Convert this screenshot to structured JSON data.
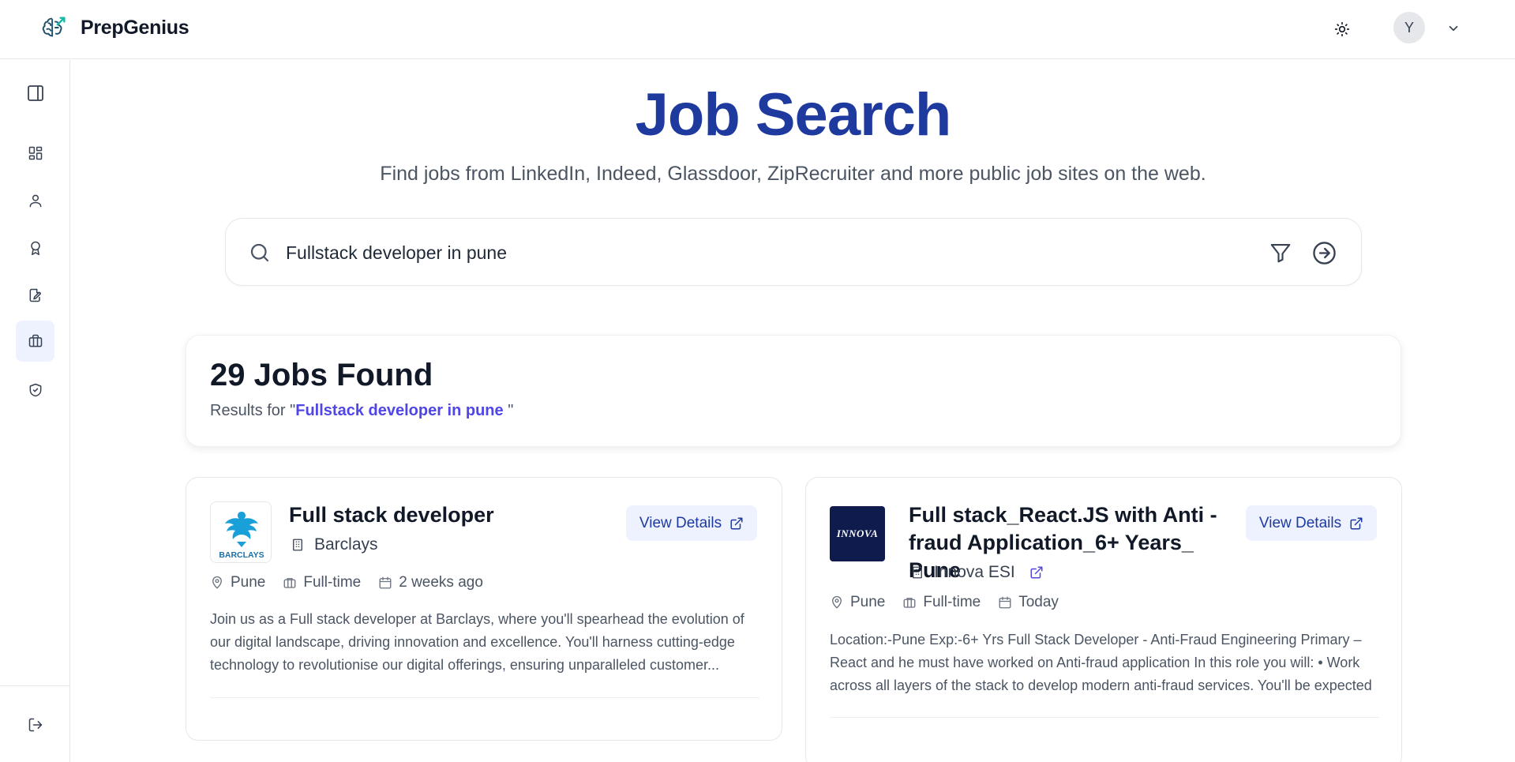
{
  "app": {
    "name": "PrepGenius",
    "user_initial": "Y"
  },
  "sidebar": {
    "items": [
      {
        "name": "toggle-sidebar",
        "icon": "panel-left-icon"
      },
      {
        "name": "dashboard",
        "icon": "dashboard-icon"
      },
      {
        "name": "profile",
        "icon": "user-icon"
      },
      {
        "name": "skills",
        "icon": "award-icon"
      },
      {
        "name": "resume",
        "icon": "file-edit-icon"
      },
      {
        "name": "jobs",
        "icon": "briefcase-icon",
        "active": true
      },
      {
        "name": "security",
        "icon": "shield-check-icon"
      },
      {
        "name": "logout",
        "icon": "logout-icon"
      }
    ]
  },
  "header": {
    "title": "Job Search",
    "subtitle": "Find jobs from LinkedIn, Indeed, Glassdoor, ZipRecruiter and more public job sites on the web."
  },
  "search": {
    "value": "Fullstack developer in pune"
  },
  "results": {
    "count_label": "29 Jobs Found",
    "for_prefix": "Results for \"",
    "query": "Fullstack developer in pune",
    "for_suffix": " \""
  },
  "jobs": [
    {
      "title": "Full stack developer",
      "company": "Barclays",
      "logo_text": "BARCLAYS",
      "location": "Pune",
      "type": "Full-time",
      "posted": "2 weeks ago",
      "view_label": "View Details",
      "description": "Join us as a Full stack developer at Barclays, where you'll spearhead the evolution of our digital landscape, driving innovation and excellence. You'll harness cutting-edge technology to revolutionise our digital offerings, ensuring unparalleled customer..."
    },
    {
      "title": "Full stack_React.JS with Anti - fraud Application_6+ Years_ Pune",
      "company": "Innova ESI",
      "logo_text": "INNOVA",
      "location": "Pune",
      "type": "Full-time",
      "posted": "Today",
      "view_label": "View Details",
      "description": "Location:-Pune Exp:-6+ Yrs Full Stack Developer - Anti-Fraud Engineering Primary – React and he must have worked on Anti-fraud application In this role you will: • Work across all layers of the stack to develop modern anti-fraud services. You'll be expected to provide..."
    }
  ],
  "colors": {
    "title": "#1e3a9f",
    "accent": "#4f46e5",
    "button_bg": "#eef2ff"
  }
}
